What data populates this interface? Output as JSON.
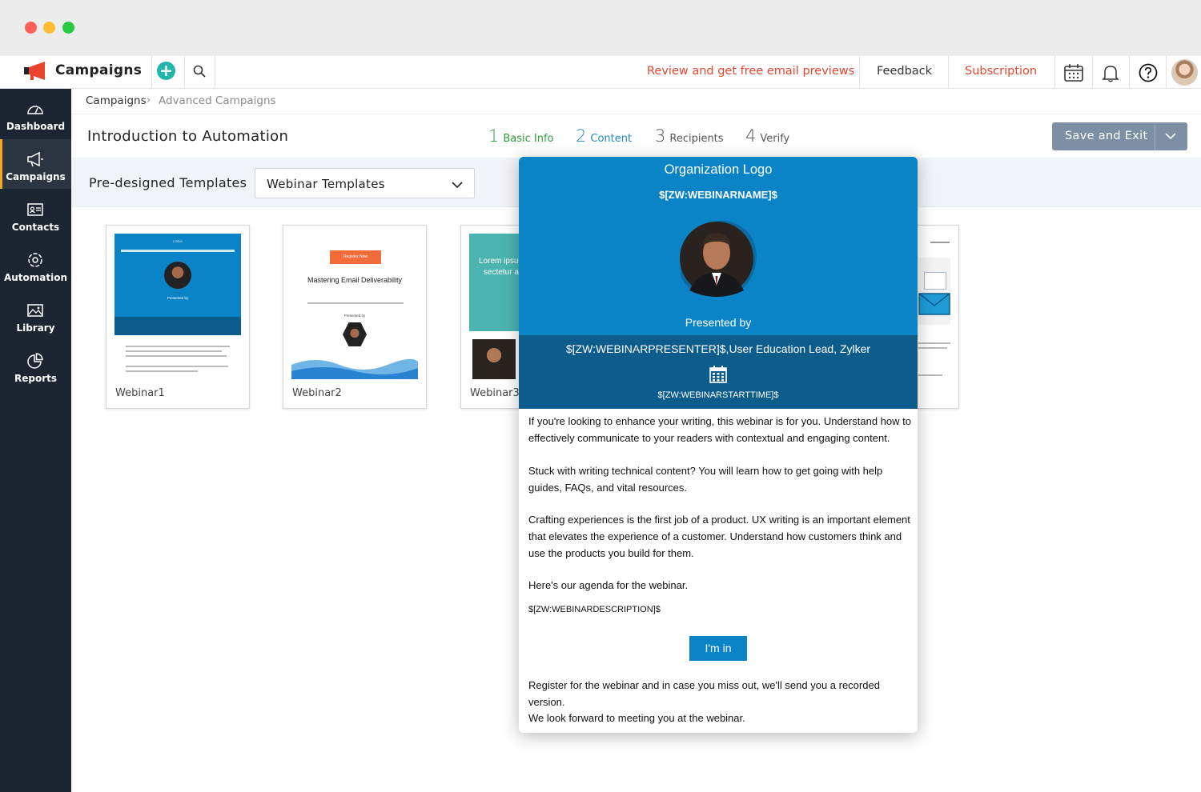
{
  "app": {
    "title": "Campaigns"
  },
  "topbar": {
    "review_link": "Review and get free email previews",
    "feedback": "Feedback",
    "subscription": "Subscription"
  },
  "sidebar": {
    "items": [
      {
        "label": "Dashboard",
        "icon": "dashboard-gauge-icon"
      },
      {
        "label": "Campaigns",
        "icon": "megaphone-icon",
        "active": true
      },
      {
        "label": "Contacts",
        "icon": "contact-card-icon"
      },
      {
        "label": "Automation",
        "icon": "automation-gear-icon"
      },
      {
        "label": "Library",
        "icon": "image-library-icon"
      },
      {
        "label": "Reports",
        "icon": "pie-chart-icon"
      }
    ]
  },
  "breadcrumb": {
    "root": "Campaigns",
    "current": "Advanced Campaigns"
  },
  "page": {
    "title": "Introduction to Automation"
  },
  "steps": [
    {
      "num": "1",
      "label": "Basic Info",
      "state": "done"
    },
    {
      "num": "2",
      "label": "Content",
      "state": "current"
    },
    {
      "num": "3",
      "label": "Recipients",
      "state": "pending"
    },
    {
      "num": "4",
      "label": "Verify",
      "state": "pending"
    }
  ],
  "actions": {
    "save_exit": "Save and Exit"
  },
  "templates": {
    "label": "Pre-designed Templates",
    "selected": "Webinar Templates",
    "cards": [
      {
        "name": "Webinar1"
      },
      {
        "name": "Webinar2"
      },
      {
        "name": "Webinar3"
      }
    ],
    "thumb1": {
      "logo": "LOGO",
      "presented": "Presented by"
    },
    "thumb2": {
      "register": "Register Now",
      "title": "Mastering Email Deliverability",
      "presented": "Presented by"
    },
    "thumb3": {
      "text1": "Lorem ipsum",
      "text2": "sectetur a"
    }
  },
  "preview": {
    "org_logo": "Organization Logo",
    "webinar_name": "$[ZW:WEBINARNAME]$",
    "presented_by": "Presented by",
    "presenter": "$[ZW:WEBINARPRESENTER]$,User Education Lead, Zylker",
    "start_time": "$[ZW:WEBINARSTARTTIME]$",
    "paragraphs": [
      "If you're looking to enhance your writing, this webinar is for you. Understand how to effectively communicate to your readers with contextual and engaging content.",
      "Stuck with writing technical content? You will learn how to get going with help guides, FAQs, and vital resources.",
      "Crafting experiences is the first job of a product. UX writing is an important element that elevates the experience of a customer. Understand how customers think and use the products you build for them.",
      "Here's our agenda for the webinar."
    ],
    "description": "$[ZW:WEBINARDESCRIPTION]$",
    "cta": "I'm in",
    "closing1": "Register for the webinar and in case you miss out, we'll send you a recorded version.",
    "closing2": "We look forward to meeting you at the webinar."
  },
  "colors": {
    "accent": "#e8432d",
    "teal": "#21b6a8",
    "sidebar_bg": "#1c2532",
    "active_indicator": "#f4a623",
    "preview_blue": "#0a84c6",
    "preview_dark_blue": "#0c5d8c",
    "step_done": "#2a9d3a",
    "step_current": "#1f8bc2"
  }
}
